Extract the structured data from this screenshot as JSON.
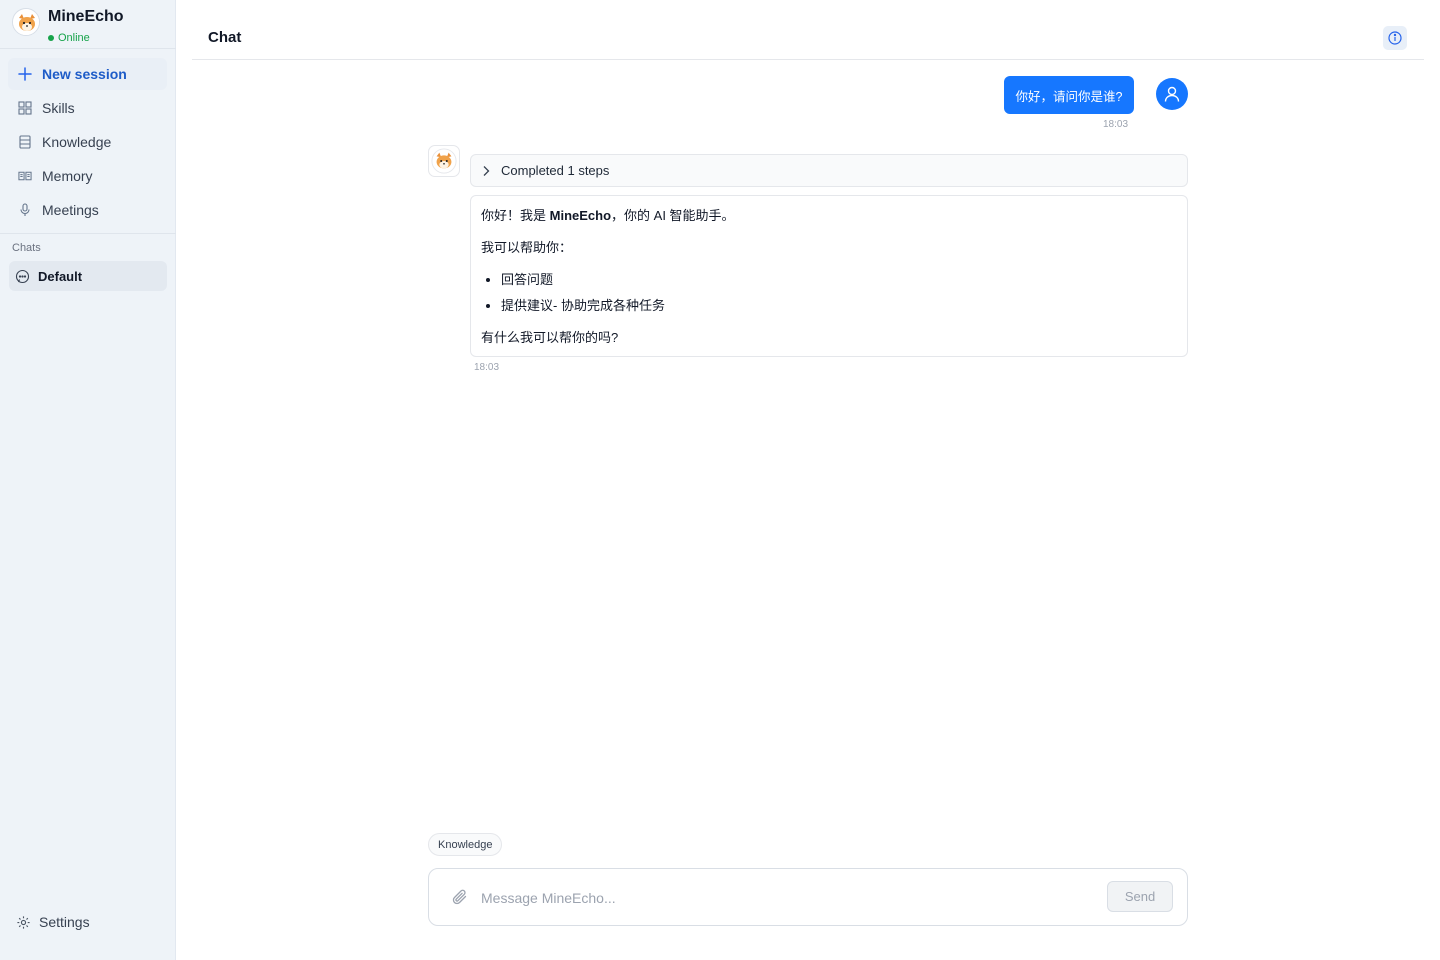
{
  "sidebar": {
    "brand": {
      "name": "MineEcho",
      "status": "Online",
      "avatar_icon": "shiba-dog-avatar"
    },
    "nav": [
      {
        "label": "New session",
        "icon": "plus-icon"
      },
      {
        "label": "Skills",
        "icon": "grid-icon"
      },
      {
        "label": "Knowledge",
        "icon": "database-icon"
      },
      {
        "label": "Memory",
        "icon": "book-icon"
      },
      {
        "label": "Meetings",
        "icon": "microphone-icon"
      }
    ],
    "chats_label": "Chats",
    "chats": [
      {
        "label": "Default",
        "icon": "chat-bubble-icon"
      }
    ],
    "settings_label": "Settings"
  },
  "header": {
    "title": "Chat",
    "info_icon": "info-icon"
  },
  "messages": {
    "user": {
      "text": "你好，请问你是谁?",
      "time": "18:03"
    },
    "assistant": {
      "steps_label": "Completed 1 steps",
      "greeting_pre": "你好！我是 ",
      "greeting_name": "MineEcho",
      "greeting_post": "，你的 AI 智能助手。",
      "intro": "我可以帮助你：",
      "bullets": [
        "回答问题",
        "提供建议- 协助完成各种任务"
      ],
      "closing": "有什么我可以帮你的吗?",
      "time": "18:03"
    }
  },
  "composer": {
    "chip": "Knowledge",
    "placeholder": "Message MineEcho...",
    "send_label": "Send"
  },
  "colors": {
    "accent": "#1677ff",
    "online": "#16a34a",
    "sidebar_bg": "#eef3f8"
  }
}
